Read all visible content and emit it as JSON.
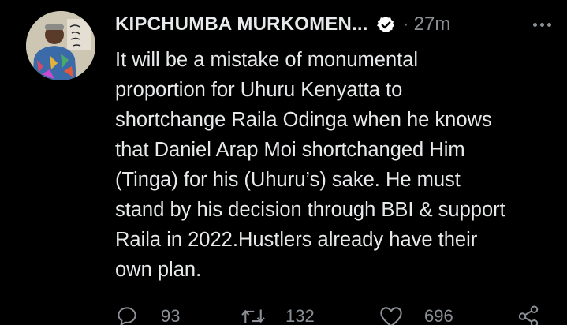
{
  "tweet": {
    "author_name": "KIPCHUMBA MURKOMEN...",
    "verified_icon": "verified-badge-icon",
    "separator": "·",
    "time": "27m",
    "more_icon": "more-options-icon",
    "text_lines": [
      "It will be a mistake of monumental",
      "proportion for Uhuru Kenyatta to",
      "shortchange Raila Odinga when he knows",
      "that Daniel Arap Moi shortchanged Him",
      "(Tinga) for his (Uhuru’s) sake. He must",
      "stand by his decision through BBI & support",
      "Raila in 2022.Hustlers already have their",
      "own plan."
    ],
    "actions": {
      "reply": {
        "icon": "reply-icon",
        "count": "93"
      },
      "retweet": {
        "icon": "retweet-icon",
        "count": "132"
      },
      "like": {
        "icon": "heart-icon",
        "count": "696"
      },
      "share": {
        "icon": "share-icon"
      }
    }
  },
  "colors": {
    "background": "#000000",
    "primary_text": "#e7e9ea",
    "secondary_text": "#8b9096",
    "verified_badge": "#ffffff"
  }
}
